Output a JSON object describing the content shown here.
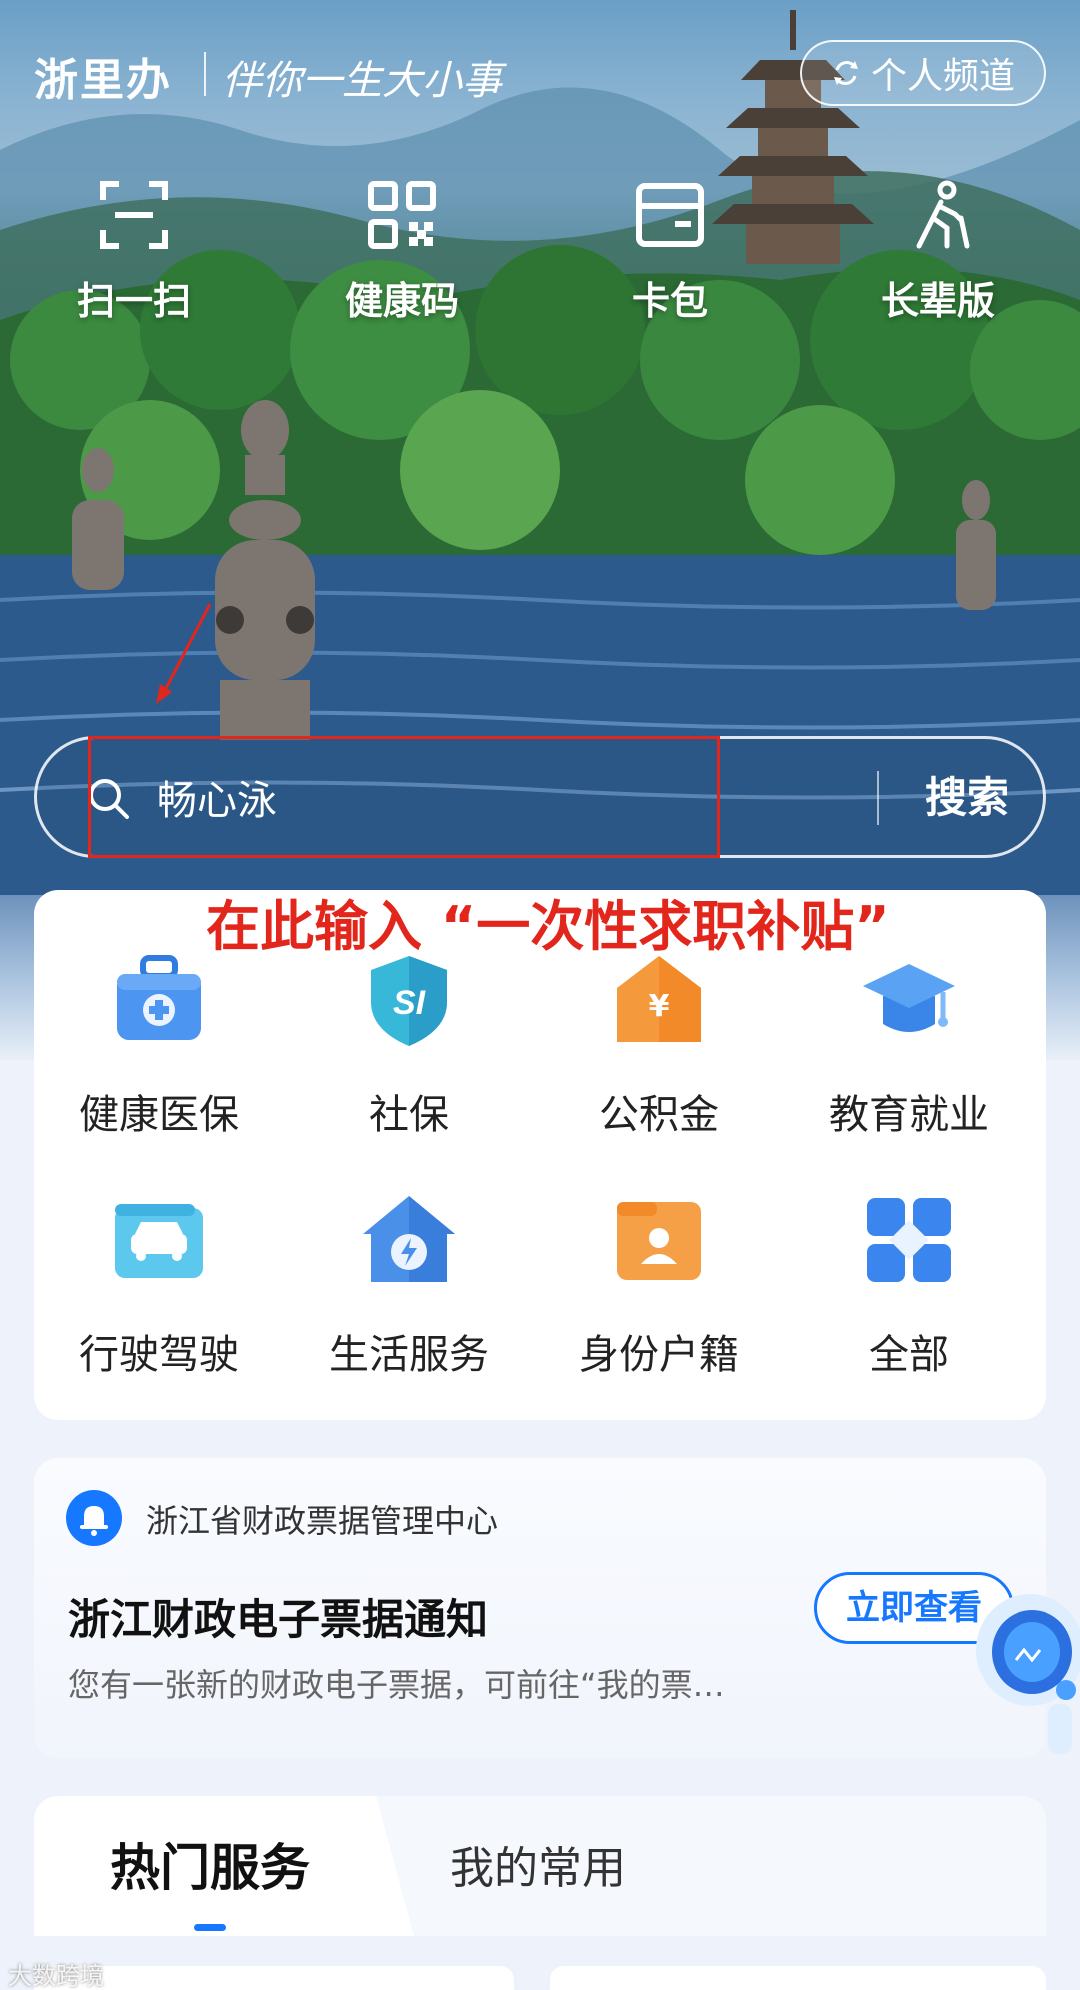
{
  "header": {
    "brand": "浙里办",
    "slogan": "伴你一生大小事",
    "personal_channel": "个人频道"
  },
  "quick_tools": [
    {
      "label": "扫一扫",
      "icon": "scan-icon"
    },
    {
      "label": "健康码",
      "icon": "qr-code-icon"
    },
    {
      "label": "卡包",
      "icon": "card-wallet-icon"
    },
    {
      "label": "长辈版",
      "icon": "elder-mode-icon"
    }
  ],
  "search": {
    "value": "畅心泳",
    "button_label": "搜索"
  },
  "annotation": {
    "text": "在此输入 “一次性求职补贴”",
    "color": "#e2261c"
  },
  "services": [
    {
      "label": "健康医保",
      "icon": "medical-kit-icon"
    },
    {
      "label": "社保",
      "icon": "social-security-shield-icon"
    },
    {
      "label": "公积金",
      "icon": "housing-fund-icon"
    },
    {
      "label": "教育就业",
      "icon": "graduation-cap-icon"
    },
    {
      "label": "行驶驾驶",
      "icon": "car-icon"
    },
    {
      "label": "生活服务",
      "icon": "home-power-icon"
    },
    {
      "label": "身份户籍",
      "icon": "id-profile-icon"
    },
    {
      "label": "全部",
      "icon": "all-grid-icon"
    }
  ],
  "notice": {
    "source": "浙江省财政票据管理中心",
    "title": "浙江财政电子票据通知",
    "body": "您有一张新的财政电子票据，可前往“我的票…",
    "button_label": "立即查看"
  },
  "tabs": {
    "hot": "热门服务",
    "common": "我的常用"
  },
  "watermark": "大数跨境",
  "colors": {
    "accent": "#1677ff",
    "annotation_red": "#e2261c"
  }
}
